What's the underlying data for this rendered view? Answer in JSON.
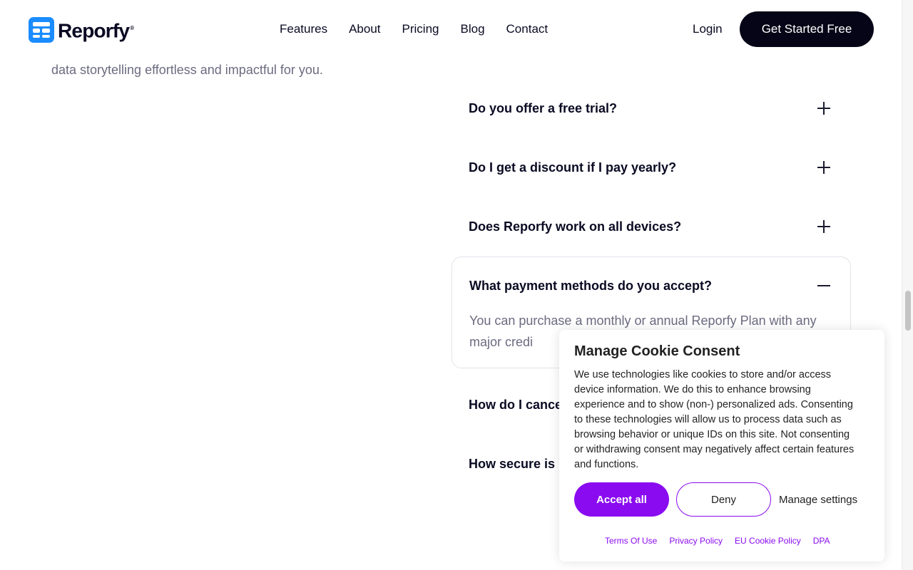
{
  "brand": {
    "name": "Reporfy",
    "registered": "®",
    "color": "#1a8cff"
  },
  "nav": {
    "items": [
      "Features",
      "About",
      "Pricing",
      "Blog",
      "Contact"
    ],
    "login": "Login",
    "cta": "Get Started Free"
  },
  "intro": {
    "tail": "data storytelling effortless and impactful for you."
  },
  "faq": {
    "items": [
      {
        "question": "Do you offer a free trial?",
        "expanded": false
      },
      {
        "question": "Do I get a discount if I pay yearly?",
        "expanded": false
      },
      {
        "question": "Does Reporfy work on all devices?",
        "expanded": false
      },
      {
        "question": "What payment methods do you accept?",
        "expanded": true,
        "answer": "You can purchase a monthly or annual Reporfy Plan with any major credi"
      },
      {
        "question": "How do I cance",
        "expanded": false
      },
      {
        "question": "How secure is",
        "expanded": false
      }
    ],
    "icons": {
      "collapsed": "plus-icon",
      "expanded": "minus-icon"
    }
  },
  "cookie": {
    "title": "Manage Cookie Consent",
    "body": "We use technologies like cookies to store and/or access device information. We do this to enhance browsing experience and to show (non-) personalized ads. Consenting to these technologies will allow us to process data such as browsing behavior or unique IDs on this site. Not consenting or withdrawing consent may negatively affect certain features and functions.",
    "accept": "Accept all",
    "deny": "Deny",
    "manage": "Manage settings",
    "links": [
      "Terms Of Use",
      "Privacy Policy",
      "EU Cookie Policy",
      "DPA"
    ],
    "accent": "#8a0bf0"
  }
}
